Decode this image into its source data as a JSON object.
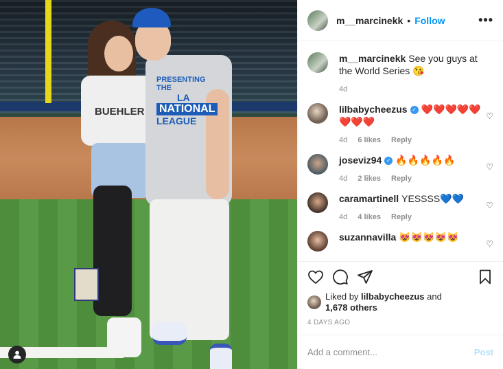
{
  "post": {
    "username": "m__marcinekk",
    "follow_label": "Follow",
    "more_label": "•••",
    "caption": {
      "username": "m__marcinekk",
      "text": "See you guys at the World Series 😘",
      "time": "4d"
    }
  },
  "photo": {
    "shirt_lines": [
      "PRESENTING THE",
      "LA",
      "NATIONAL",
      "LEAGUE"
    ],
    "woman_shirt": "BUEHLER"
  },
  "comments": [
    {
      "username": "lilbabycheezus",
      "verified": true,
      "text": "❤️❤️❤️❤️❤️❤️❤️❤️",
      "time": "4d",
      "likes": "6 likes",
      "reply": "Reply"
    },
    {
      "username": "joseviz94",
      "verified": true,
      "text": "🔥🔥🔥🔥🔥",
      "time": "4d",
      "likes": "2 likes",
      "reply": "Reply"
    },
    {
      "username": "caramartinell",
      "verified": false,
      "text": "YESSSS💙💙",
      "time": "4d",
      "likes": "4 likes",
      "reply": "Reply"
    },
    {
      "username": "suzannavilla",
      "verified": false,
      "text": "😻😻😻😻😻",
      "time": "",
      "likes": "",
      "reply": ""
    }
  ],
  "likes": {
    "prefix": "Liked by",
    "user": "lilbabycheezus",
    "and": "and",
    "others": "1,678 others"
  },
  "timestamp": "4 DAYS AGO",
  "add_comment": {
    "placeholder": "Add a comment...",
    "post_label": "Post"
  },
  "colors": {
    "accent": "#0095f6",
    "post_disabled": "#b2dffc"
  }
}
